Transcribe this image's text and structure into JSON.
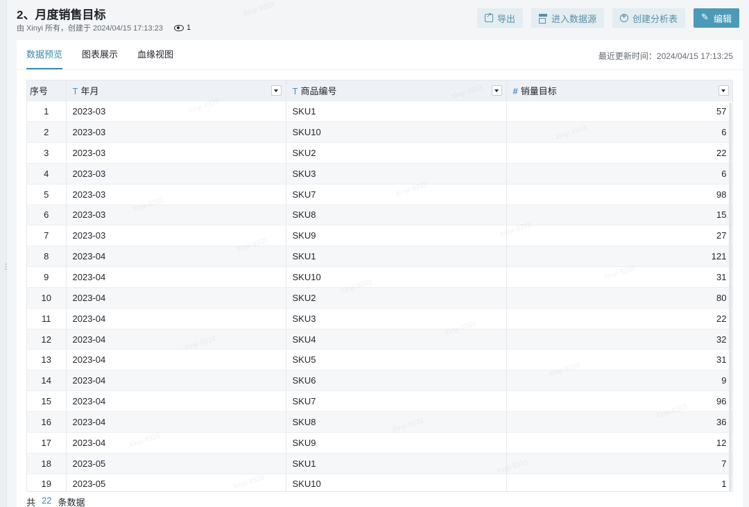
{
  "header": {
    "title": "2、月度销售目标",
    "meta": "由 Xinyi 所有，创建于 2024/04/15 17:13:23",
    "view_count": "1"
  },
  "actions": {
    "export": "导出",
    "datasource": "进入数据源",
    "create_analysis": "创建分析表",
    "edit": "编辑"
  },
  "tabs": [
    {
      "label": "数据预览",
      "active": true
    },
    {
      "label": "图表展示",
      "active": false
    },
    {
      "label": "血缘视图",
      "active": false
    }
  ],
  "updated": "最近更新时间：2024/04/15 17:13:25",
  "table": {
    "columns": [
      {
        "label": "序号",
        "type": ""
      },
      {
        "label": "年月",
        "type": "T"
      },
      {
        "label": "商品编号",
        "type": "T"
      },
      {
        "label": "销量目标",
        "type": "#"
      }
    ],
    "rows": [
      [
        "1",
        "2023-03",
        "SKU1",
        "57"
      ],
      [
        "2",
        "2023-03",
        "SKU10",
        "6"
      ],
      [
        "3",
        "2023-03",
        "SKU2",
        "22"
      ],
      [
        "4",
        "2023-03",
        "SKU3",
        "6"
      ],
      [
        "5",
        "2023-03",
        "SKU7",
        "98"
      ],
      [
        "6",
        "2023-03",
        "SKU8",
        "15"
      ],
      [
        "7",
        "2023-03",
        "SKU9",
        "27"
      ],
      [
        "8",
        "2023-04",
        "SKU1",
        "121"
      ],
      [
        "9",
        "2023-04",
        "SKU10",
        "31"
      ],
      [
        "10",
        "2023-04",
        "SKU2",
        "80"
      ],
      [
        "11",
        "2023-04",
        "SKU3",
        "22"
      ],
      [
        "12",
        "2023-04",
        "SKU4",
        "32"
      ],
      [
        "13",
        "2023-04",
        "SKU5",
        "31"
      ],
      [
        "14",
        "2023-04",
        "SKU6",
        "9"
      ],
      [
        "15",
        "2023-04",
        "SKU7",
        "96"
      ],
      [
        "16",
        "2023-04",
        "SKU8",
        "36"
      ],
      [
        "17",
        "2023-04",
        "SKU9",
        "12"
      ],
      [
        "18",
        "2023-05",
        "SKU1",
        "7"
      ],
      [
        "19",
        "2023-05",
        "SKU10",
        "1"
      ]
    ]
  },
  "footer": {
    "prefix": "共",
    "count": "22",
    "suffix": "条数据"
  },
  "watermark": "Xinyi 8333",
  "colors": {
    "accent": "#3a8aab",
    "primary_button": "#4b9ab7",
    "secondary_button": "#e3edf2",
    "header_bg": "#eef1f5",
    "type_icon": "#4b8fc4"
  }
}
